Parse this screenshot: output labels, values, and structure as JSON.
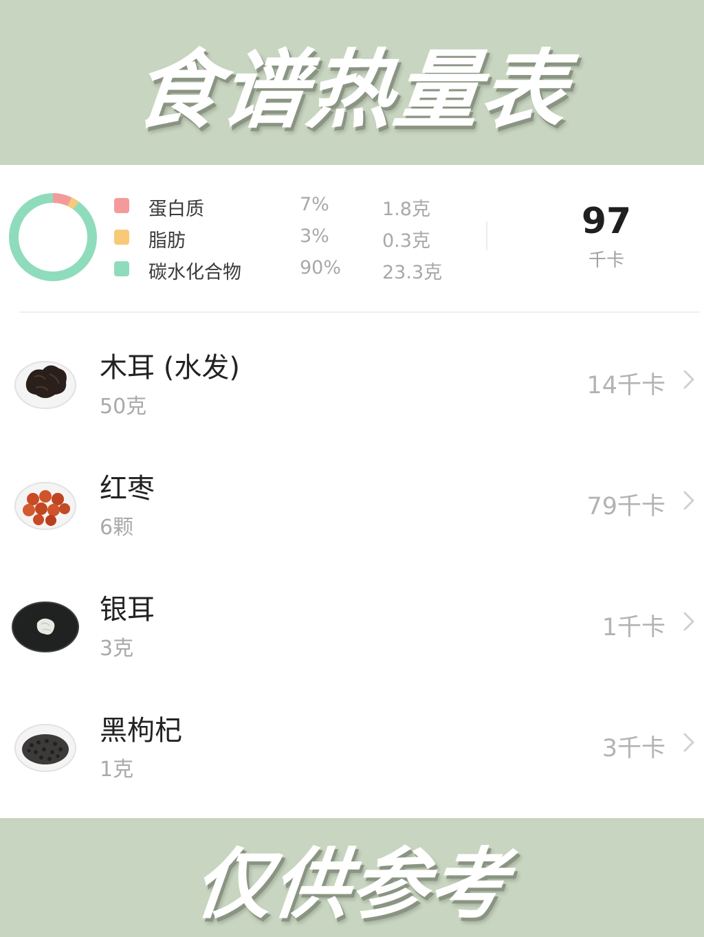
{
  "header": {
    "title": "食谱热量表"
  },
  "summary": {
    "nutrients": [
      {
        "name": "蛋白质",
        "percent": "7%",
        "grams": "1.8克",
        "color": "#f59a9a",
        "fraction": 0.07
      },
      {
        "name": "脂肪",
        "percent": "3%",
        "grams": "0.3克",
        "color": "#f9c97a",
        "fraction": 0.03
      },
      {
        "name": "碳水化合物",
        "percent": "90%",
        "grams": "23.3克",
        "color": "#8fdcbc",
        "fraction": 0.9
      }
    ],
    "total_kcal": "97",
    "kcal_unit": "千卡"
  },
  "ingredients": [
    {
      "name": "木耳 (水发)",
      "quantity": "50克",
      "kcal": "14千卡",
      "icon": "black-fungus-icon"
    },
    {
      "name": "红枣",
      "quantity": "6颗",
      "kcal": "79千卡",
      "icon": "red-dates-icon"
    },
    {
      "name": "银耳",
      "quantity": "3克",
      "kcal": "1千卡",
      "icon": "white-fungus-icon"
    },
    {
      "name": "黑枸杞",
      "quantity": "1克",
      "kcal": "3千卡",
      "icon": "black-goji-icon"
    }
  ],
  "footer": {
    "text": "仅供参考"
  }
}
